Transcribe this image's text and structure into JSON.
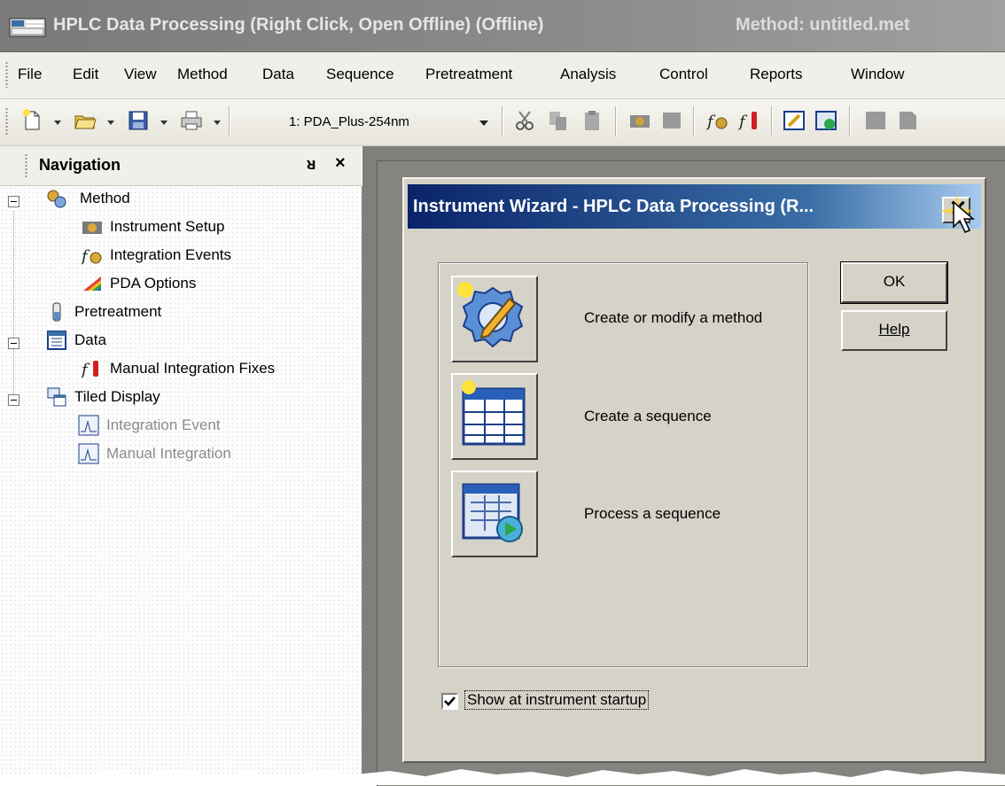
{
  "window": {
    "title": "HPLC Data Processing (Right Click, Open Offline) (Offline)",
    "method": "Method: untitled.met"
  },
  "menu": [
    "File",
    "Edit",
    "View",
    "Method",
    "Data",
    "Sequence",
    "Pretreatment",
    "Analysis",
    "Control",
    "Reports",
    "Window"
  ],
  "toolbar": {
    "instrument_combo": "1: PDA_Plus-254nm"
  },
  "navigation": {
    "title": "Navigation",
    "pin": "↕",
    "close": "×",
    "tree": {
      "method": "Method",
      "instrument_setup": "Instrument Setup",
      "integration_events": "Integration Events",
      "pda_options": "PDA Options",
      "pretreatment": "Pretreatment",
      "data": "Data",
      "manual_integration_fixes": "Manual Integration Fixes",
      "tiled_display": "Tiled Display",
      "integration_event": "Integration Event",
      "manual_integration": "Manual Integration"
    }
  },
  "wizard": {
    "title": "Instrument Wizard - HPLC Data Processing (R...",
    "tasks": {
      "create_method": "Create or modify a method",
      "create_sequence": "Create a sequence",
      "process_sequence": "Process a sequence"
    },
    "ok": "OK",
    "help": "Help",
    "show_at_startup": "Show at instrument startup",
    "show_at_startup_checked": true
  },
  "colors": {
    "dialog_title_start": "#0a246a",
    "dialog_title_end": "#a6caf0",
    "mdi_background": "#807f7c"
  }
}
